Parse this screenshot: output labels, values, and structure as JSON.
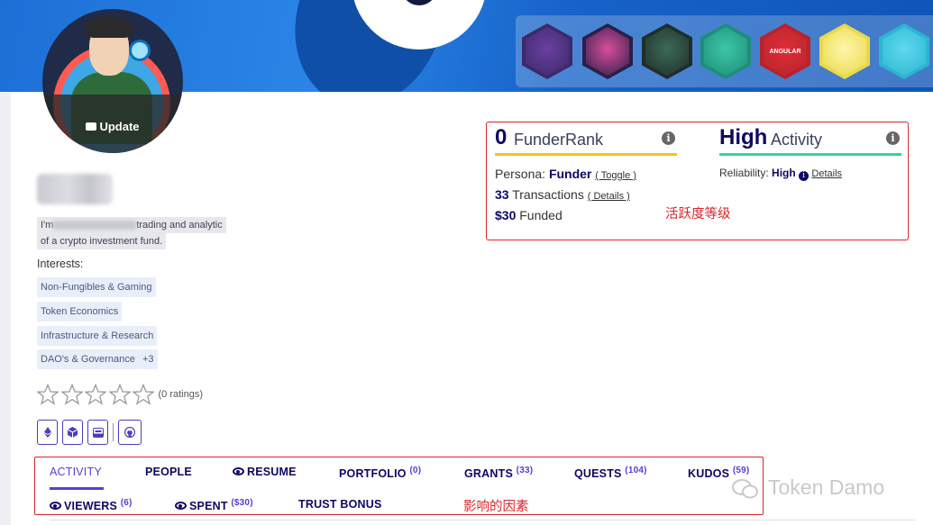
{
  "banner": {
    "badges": [
      {
        "icon": "atom-icon",
        "color": "#3a2a6a",
        "inner": "#6b3fa0"
      },
      {
        "icon": "mountain-icon",
        "color": "#2b1e4a",
        "inner": "#d94f9a"
      },
      {
        "icon": "triangle-icon",
        "color": "#1f2e2a",
        "inner": "#3d6a56"
      },
      {
        "icon": "boat-icon",
        "color": "#1d8e7a",
        "inner": "#3cc6a4"
      },
      {
        "icon": "angular-icon",
        "color": "#b8222c",
        "inner": "#dd2f38",
        "text": "ANGULAR"
      },
      {
        "icon": "robot-icon",
        "color": "#e8d84a",
        "inner": "#fff6a8"
      },
      {
        "icon": "diamond-icon",
        "color": "#2bb6cf",
        "inner": "#5fd9ef"
      }
    ]
  },
  "profile": {
    "update_label": "Update",
    "bio_prefix": "I'm",
    "bio_suffix": "trading and analytic",
    "bio_line2": "of a crypto investment fund.",
    "interests_label": "Interests:",
    "interests": [
      "Non-Fungibles & Gaming",
      "Token Economics",
      "Infrastructure & Research",
      "DAO's & Governance"
    ],
    "interests_more": "+3",
    "rating_text": "(0 ratings)",
    "star_count": 5
  },
  "stats": {
    "funder_rank_value": "0",
    "funder_rank_label": "FunderRank",
    "persona_label": "Persona:",
    "persona_value": "Funder",
    "toggle_link": "( Toggle )",
    "transactions_value": "33",
    "transactions_label": "Transactions",
    "details_link": "( Details )",
    "funded_value": "$30",
    "funded_label": "Funded",
    "activity_value": "High",
    "activity_label": "Activity",
    "reliability_label": "Reliability:",
    "reliability_value": "High",
    "reliability_details": "Details",
    "annotation": "活跃度等级",
    "colors": {
      "funder_rule": "#f5c518",
      "activity_rule": "#2ed6a0",
      "annotation": "#d9262c"
    }
  },
  "tabs": {
    "activity": "ACTIVITY",
    "people": "PEOPLE",
    "resume": "RESUME",
    "portfolio": "PORTFOLIO",
    "portfolio_count": "(0)",
    "grants": "GRANTS",
    "grants_count": "(33)",
    "quests": "QUESTS",
    "quests_count": "(104)",
    "kudos": "KUDOS",
    "kudos_count": "(59)",
    "viewers": "VIEWERS",
    "viewers_count": "(6)",
    "spent": "SPENT",
    "spent_count": "($30)",
    "trust_bonus": "TRUST BONUS",
    "annotation": "影响的因素",
    "accent": "#5540d6"
  },
  "watermark": {
    "text": "Token Damo"
  }
}
